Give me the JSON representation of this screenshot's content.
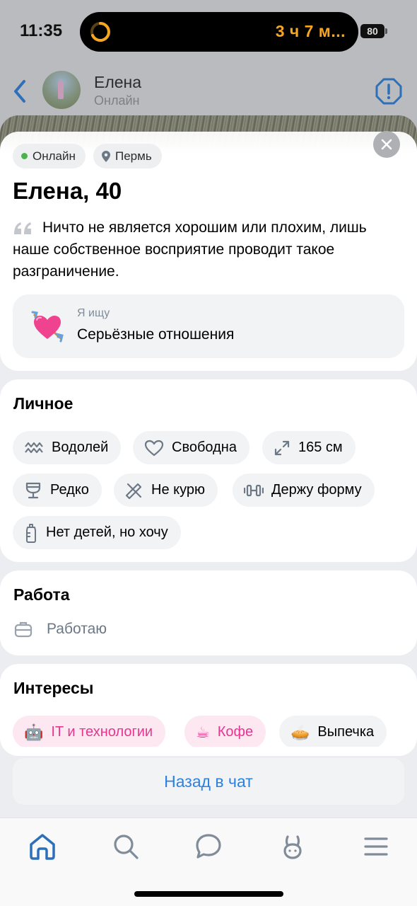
{
  "status_bar": {
    "time": "11:35",
    "activity_text": "3 ч 7 м...",
    "battery": "80"
  },
  "chat_header": {
    "name": "Елена",
    "status": "Онлайн"
  },
  "profile": {
    "online_chip": "Онлайн",
    "city_chip": "Пермь",
    "name_age": "Елена, 40",
    "quote": "Ничто не является хорошим или плохим, лишь наше собственное восприятие проводит такое разграничение.",
    "seeking": {
      "emoji": "heart-with-arrow",
      "label": "Я ищу",
      "value": "Серьёзные отношения"
    }
  },
  "personal": {
    "title": "Личное",
    "tags": [
      {
        "icon": "aquarius-icon",
        "label": "Водолей"
      },
      {
        "icon": "heart-outline-icon",
        "label": "Свободна"
      },
      {
        "icon": "height-arrows-icon",
        "label": "165 см"
      },
      {
        "icon": "wine-glass-icon",
        "label": "Редко"
      },
      {
        "icon": "no-smoking-icon",
        "label": "Не курю"
      },
      {
        "icon": "dumbbell-icon",
        "label": "Держу форму"
      },
      {
        "icon": "baby-bottle-icon",
        "label": "Нет детей, но хочу"
      }
    ]
  },
  "work": {
    "title": "Работа",
    "value": "Работаю"
  },
  "interests": {
    "title": "Интересы",
    "tags": [
      {
        "emoji": "🤖",
        "label": "IT и технологии",
        "highlight": true
      },
      {
        "emoji": "☕",
        "label": "Кофе",
        "highlight": true
      },
      {
        "emoji": "🥧",
        "label": "Выпечка",
        "highlight": false
      }
    ]
  },
  "back_to_chat": "Назад в чат",
  "tabbar": [
    "home-icon",
    "search-icon",
    "chat-icon",
    "bunny-icon",
    "menu-icon"
  ],
  "colors": {
    "accent": "#2d81e0",
    "online": "#4bb34b",
    "interest_pink": "#e6378f",
    "island_orange": "#f5a623"
  }
}
